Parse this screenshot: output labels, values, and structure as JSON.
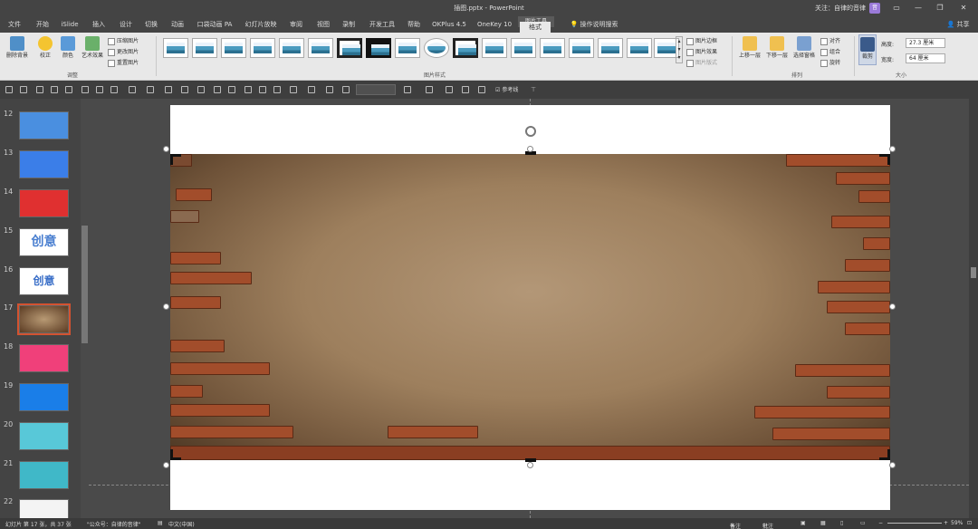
{
  "window": {
    "title": "插图.pptx  -  PowerPoint",
    "follow_text": "关注：自律的音律",
    "avatar_text": "音"
  },
  "tool_tab_tag": "图片工具",
  "tabs": [
    "文件",
    "开始",
    "iSlide",
    "插入",
    "设计",
    "切换",
    "动画",
    "口袋动画 PA",
    "幻灯片放映",
    "审阅",
    "视图",
    "录制",
    "开发工具",
    "帮助",
    "OKPlus 4.5",
    "OneKey 10",
    "格式"
  ],
  "search_label": "操作说明搜索",
  "share_label": "共享",
  "ribbon": {
    "remove_bg": "删除背景",
    "adjust": {
      "correct": "校正",
      "color": "颜色",
      "art": "艺术效果",
      "compress": "压缩图片",
      "change": "更改图片",
      "reset": "重置图片",
      "label": "调整"
    },
    "styles": {
      "label": "图片样式",
      "border": "图片边框",
      "effects": "图片效果",
      "layout": "图片版式"
    },
    "arrange": {
      "forward": "上移一层",
      "backward": "下移一层",
      "pane": "选择窗格",
      "align": "对齐",
      "group": "组合",
      "rotate": "旋转",
      "label": "排列"
    },
    "size": {
      "crop": "裁剪",
      "height_label": "高度:",
      "height": "27.3 厘米",
      "width_label": "宽度:",
      "width": "64 厘米",
      "label": "大小"
    }
  },
  "qat": {
    "guides": "参考线"
  },
  "slides": [
    {
      "num": "12",
      "color": "#4a8fe0"
    },
    {
      "num": "13",
      "color": "#3b7ee8"
    },
    {
      "num": "14",
      "color": "#e03030"
    },
    {
      "num": "15",
      "color": "#e8eef8",
      "text": "创意"
    },
    {
      "num": "16",
      "color": "#f4f6fa",
      "text": "创意"
    },
    {
      "num": "17",
      "color": "#8a6a4a",
      "selected": true
    },
    {
      "num": "18",
      "color": "#f0407a"
    },
    {
      "num": "19",
      "color": "#1a7ee8"
    },
    {
      "num": "20",
      "color": "#58c8d8"
    },
    {
      "num": "21",
      "color": "#40b8c8"
    },
    {
      "num": "22",
      "color": "#f4f4f4"
    }
  ],
  "status": {
    "slide_info": "幻灯片 第 17 张，共 37 张",
    "account": "\"公众号：自律的音律\"",
    "lang": "中文(中国)",
    "notes": "备注",
    "comments": "批注",
    "zoom": "59%"
  }
}
